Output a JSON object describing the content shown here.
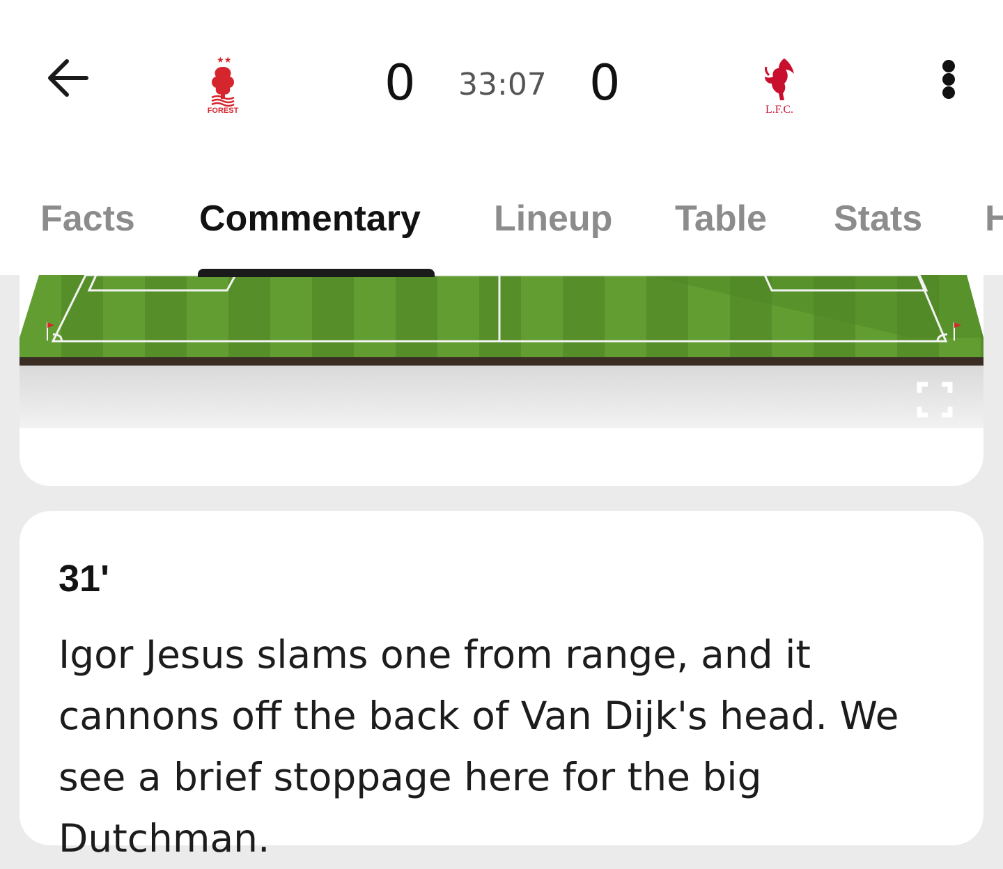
{
  "header": {
    "back_icon": "arrow-left-icon",
    "home_team": {
      "logo_text": "FOREST",
      "logo_color": "#d4262c",
      "score": "0"
    },
    "clock": "33:07",
    "away_team": {
      "logo_text": "L.F.C.",
      "logo_color": "#c8102e",
      "score": "0"
    },
    "more_icon": "more-vertical-icon"
  },
  "tabs": [
    {
      "label": "Facts"
    },
    {
      "label": "Commentary",
      "active": true
    },
    {
      "label": "Lineup"
    },
    {
      "label": "Table"
    },
    {
      "label": "Stats"
    },
    {
      "label": "H"
    }
  ],
  "pitch": {
    "expand_icon": "fullscreen-icon",
    "grass_color": "#5e9a2e"
  },
  "commentary": [
    {
      "minute": "31'",
      "text": "Igor Jesus slams one from range, and it cannons off the back of Van Dijk's head. We see a brief stoppage here for the big Dutchman."
    }
  ]
}
